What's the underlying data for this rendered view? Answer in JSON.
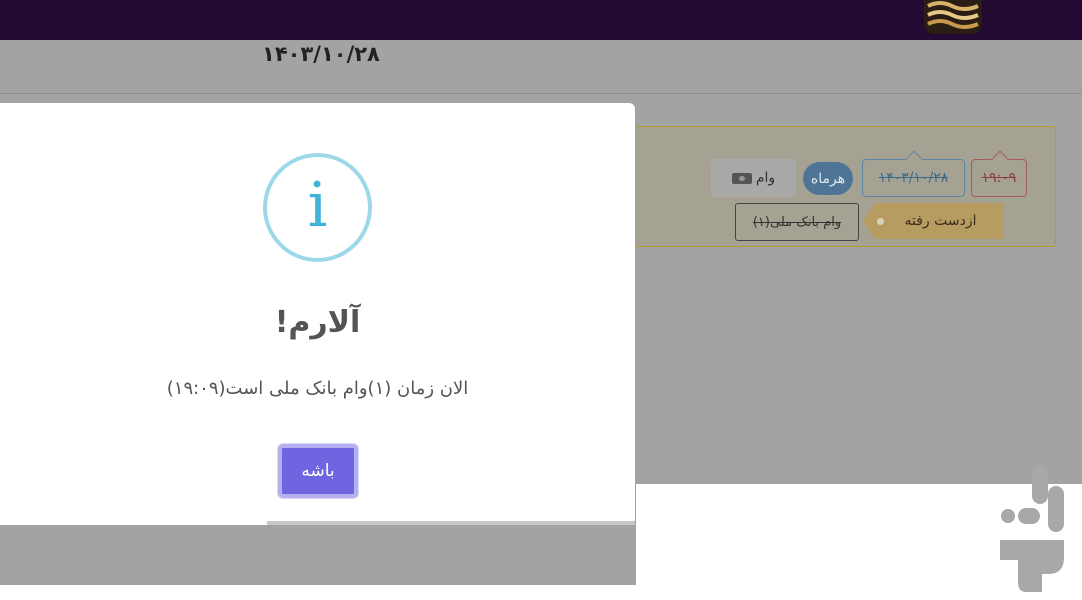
{
  "header": {
    "logo_icon": "brand-logo-icon",
    "date": "۱۴۰۳/۱۰/۲۸"
  },
  "reminder_card": {
    "time": "۱۹:۰۹",
    "date": "۱۴۰۳/۱۰/۲۸",
    "repeat": "هرماه",
    "category": "وام",
    "category_icon": "cash-icon",
    "status": "ازدست رفته",
    "name": "(۱)وام بانک ملی",
    "border_color": "#b39a32"
  },
  "dialog": {
    "icon": "i",
    "icon_name": "info-icon",
    "title": "آلارم!",
    "message": "الان زمان (۱)وام بانک ملی است(۱۹:۰۹)",
    "ok_label": "باشه",
    "accent_color": "#7065e0",
    "info_color": "#3fb3d8"
  },
  "watermark": {
    "icon_name": "pullover-logo-icon"
  }
}
